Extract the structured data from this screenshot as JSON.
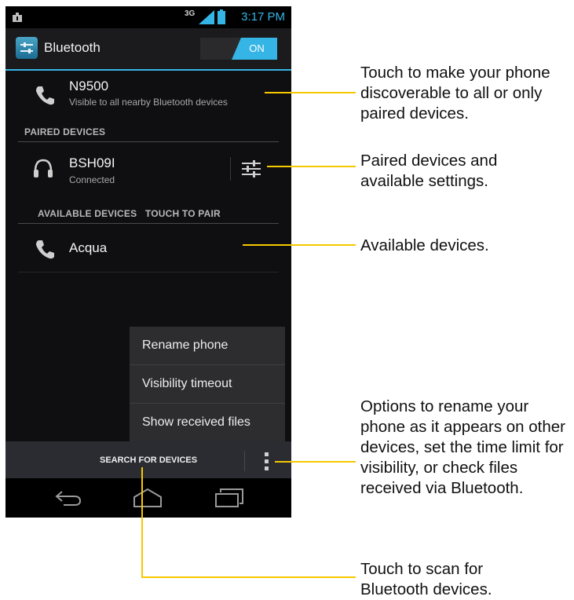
{
  "status_bar": {
    "network": "3G",
    "time": "3:17 PM",
    "icons": [
      "notification-icon",
      "network-activity-icon",
      "signal-icon",
      "battery-icon"
    ]
  },
  "action_bar": {
    "title": "Bluetooth",
    "toggle_label": "ON"
  },
  "this_device": {
    "name": "N9500",
    "subtitle": "Visible to all nearby Bluetooth devices",
    "icon": "phone-icon"
  },
  "paired": {
    "header": "PAIRED DEVICES",
    "devices": [
      {
        "name": "BSH09I",
        "status": "Connected",
        "icon": "headset-icon",
        "settings_icon": "sliders-icon"
      }
    ]
  },
  "available": {
    "header": "AVAILABLE DEVICES   TOUCH TO PAIR",
    "devices": [
      {
        "name": "Acqua",
        "icon": "phone-icon"
      }
    ]
  },
  "menu": {
    "items": [
      "Rename phone",
      "Visibility timeout",
      "Show received files"
    ]
  },
  "bottom_bar": {
    "search_label": "SEARCH FOR DEVICES",
    "overflow_icon": "overflow-menu-icon"
  },
  "nav_bar": {
    "icons": [
      "back-icon",
      "home-icon",
      "recent-apps-icon"
    ]
  },
  "callouts": {
    "discoverable": "Touch to make your phone discoverable to all or only paired devices.",
    "paired": "Paired devices and available settings.",
    "available": "Available devices.",
    "options": "Options to rename your phone as it appears on other devices, set the time limit for visibility, or check files received via Bluetooth.",
    "scan": "Touch to scan for Bluetooth devices."
  },
  "colors": {
    "accent": "#35b5e5",
    "callout_line": "#f6c800",
    "background": "#0f0f11"
  }
}
